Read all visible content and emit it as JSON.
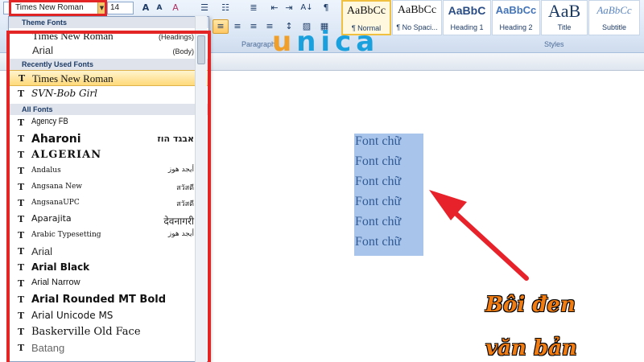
{
  "toolbar": {
    "font_name": "Times New Roman",
    "font_size": "14",
    "buttons": {
      "grow_font": "A",
      "shrink_font": "A",
      "clear_format": "A",
      "bullets": "☰",
      "numbering": "☷",
      "multilevel": "≣",
      "decrease_indent": "⇤",
      "increase_indent": "⇥",
      "sort": "A↓",
      "pilcrow": "¶",
      "align_left": "≡",
      "align_center": "≡",
      "align_right": "≡",
      "justify": "≡",
      "line_spacing": "↕",
      "shading": "▨",
      "borders": "▦"
    },
    "group_paragraph": "Paragraph",
    "group_styles": "Styles"
  },
  "styles": [
    {
      "sample": "AaBbCc",
      "label": "¶ Normal"
    },
    {
      "sample": "AaBbCc",
      "label": "¶ No Spaci..."
    },
    {
      "sample": "AaBbC",
      "label": "Heading 1"
    },
    {
      "sample": "AaBbCc",
      "label": "Heading 2"
    },
    {
      "sample": "AaB",
      "label": "Title"
    },
    {
      "sample": "AaBbCc",
      "label": "Subtitle"
    }
  ],
  "logo": {
    "first": "u",
    "rest": "nica"
  },
  "font_dropdown": {
    "theme_header": "Theme Fonts",
    "theme_fonts": [
      {
        "name": "Times New Roman",
        "role": "(Headings)"
      },
      {
        "name": "Arial",
        "role": "(Body)"
      }
    ],
    "recent_header": "Recently Used Fonts",
    "recent_fonts": [
      "Times New Roman",
      "SVN-Bob Girl"
    ],
    "all_header": "All Fonts",
    "all_fonts": [
      {
        "name": "Agency FB",
        "sample": ""
      },
      {
        "name": "Aharoni",
        "sample": "אבגד הוז"
      },
      {
        "name": "ALGERIAN",
        "sample": ""
      },
      {
        "name": "Andalus",
        "sample": "أيجد هوز"
      },
      {
        "name": "Angsana New",
        "sample": "สวัสดี"
      },
      {
        "name": "AngsanaUPC",
        "sample": "สวัสดี"
      },
      {
        "name": "Aparajita",
        "sample": "देवनागरी"
      },
      {
        "name": "Arabic Typesetting",
        "sample": "أيجد هوز"
      },
      {
        "name": "Arial",
        "sample": ""
      },
      {
        "name": "Arial Black",
        "sample": ""
      },
      {
        "name": "Arial Narrow",
        "sample": ""
      },
      {
        "name": "Arial Rounded MT Bold",
        "sample": ""
      },
      {
        "name": "Arial Unicode MS",
        "sample": ""
      },
      {
        "name": "Baskerville Old Face",
        "sample": ""
      },
      {
        "name": "Batang",
        "sample": ""
      }
    ],
    "font_icon": "T"
  },
  "document": {
    "lines": [
      "Font chữ",
      "Font chữ",
      "Font chữ",
      "Font chữ",
      "Font chữ",
      "Font chữ"
    ]
  },
  "annotation": {
    "line1": "Bôi đen",
    "line2": "văn bản"
  },
  "colors": {
    "annotation_red": "#e32526",
    "annotation_orange": "#f07c12",
    "selection": "#a9c4ea",
    "logo_orange": "#f0a02a",
    "logo_blue": "#1aa0dc"
  }
}
